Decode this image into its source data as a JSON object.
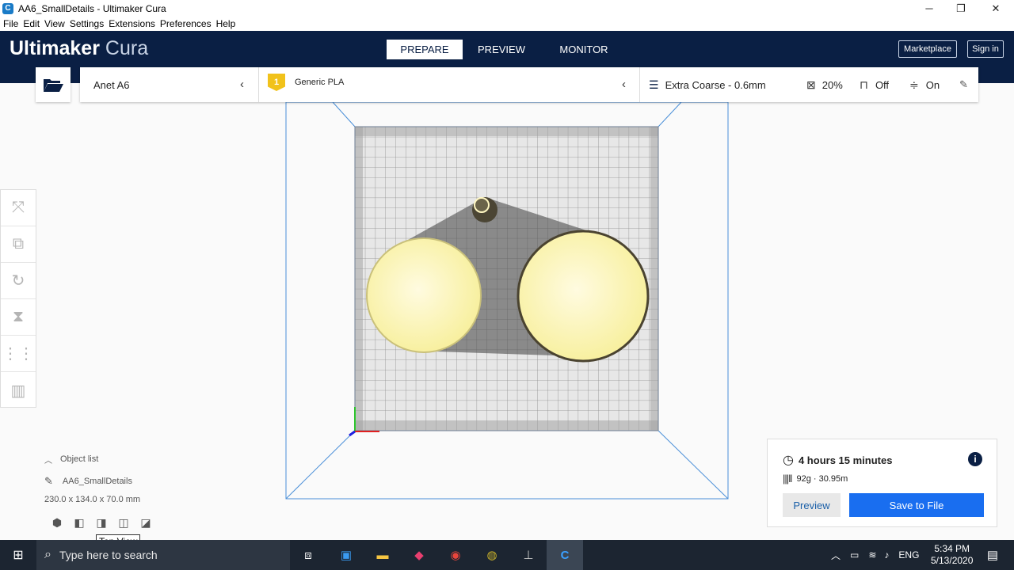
{
  "window": {
    "title": "AA6_SmallDetails - Ultimaker Cura",
    "minimize": "─",
    "maximize": "❐",
    "close": "✕"
  },
  "menu": [
    "File",
    "Edit",
    "View",
    "Settings",
    "Extensions",
    "Preferences",
    "Help"
  ],
  "header": {
    "brand_bold": "Ultimaker",
    "brand_light": "Cura",
    "tabs": {
      "prepare": "PREPARE",
      "preview": "PREVIEW",
      "monitor": "MONITOR"
    },
    "marketplace": "Marketplace",
    "signin": "Sign in"
  },
  "stage": {
    "printer": "Anet A6",
    "material_badge": "1",
    "material": "Generic PLA",
    "profile": "Extra Coarse - 0.6mm",
    "infill": "20%",
    "support": "Off",
    "adhesion": "On"
  },
  "objects": {
    "header": "Object list",
    "name": "AA6_SmallDetails",
    "dimensions": "230.0 x 134.0 x 70.0 mm"
  },
  "tooltip": "Top View",
  "print": {
    "time": "4 hours 15 minutes",
    "material": "92g · 30.95m",
    "preview_button": "Preview",
    "save_button": "Save to File"
  },
  "taskbar": {
    "search_placeholder": "Type here to search",
    "language": "ENG",
    "time": "5:34 PM",
    "date": "5/13/2020"
  },
  "colors": {
    "header_bg": "#0a1f44",
    "accent_blue": "#196ef0",
    "material_yellow": "#f1c21b",
    "taskbar_bg": "#1c2531"
  }
}
